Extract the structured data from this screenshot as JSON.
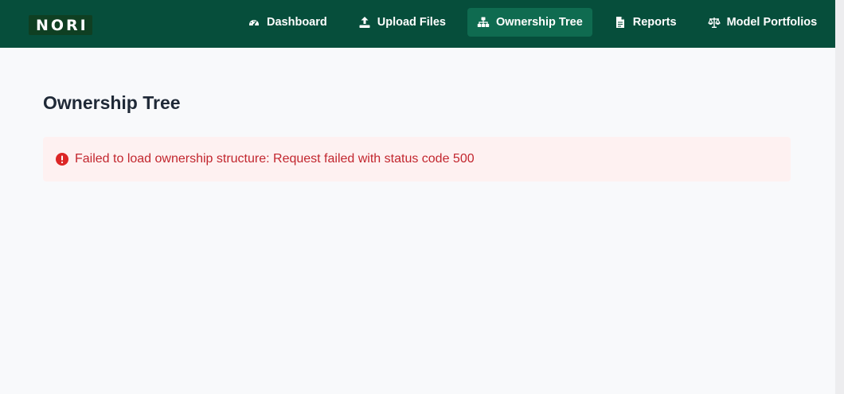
{
  "header": {
    "logo_text": "NORI",
    "nav": [
      {
        "label": "Dashboard",
        "icon": "gauge-icon",
        "active": false
      },
      {
        "label": "Upload Files",
        "icon": "upload-icon",
        "active": false
      },
      {
        "label": "Ownership Tree",
        "icon": "sitemap-icon",
        "active": true
      },
      {
        "label": "Reports",
        "icon": "file-icon",
        "active": false
      },
      {
        "label": "Model Portfolios",
        "icon": "balance-scale-icon",
        "active": false
      }
    ]
  },
  "main": {
    "title": "Ownership Tree",
    "error": {
      "icon": "exclamation-circle-icon",
      "message": "Failed to load ownership structure: Request failed with status code 500"
    }
  },
  "colors": {
    "header_bg": "#064e3b",
    "active_nav_bg": "#0f6b50",
    "error_bg": "#fef1f1",
    "error_text": "#c2262e"
  }
}
